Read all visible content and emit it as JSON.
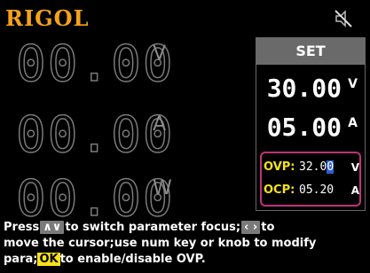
{
  "header": {
    "brand": "RIGOL",
    "mute_icon": "speaker-mute-icon"
  },
  "measurement": {
    "voltage": {
      "value": "00.00",
      "unit": "V"
    },
    "current": {
      "value": "00.00",
      "unit": "A"
    },
    "power": {
      "value": "00.00",
      "unit": "W"
    }
  },
  "set_panel": {
    "title": "SET",
    "voltage": {
      "value": "30.00",
      "unit": "V"
    },
    "current": {
      "value": "05.00",
      "unit": "A"
    },
    "ovp": {
      "label": "OVP:",
      "value_pre": "32.0",
      "value_cursor": "0",
      "unit": "V"
    },
    "ocp": {
      "label": "OCP:",
      "value": "05.20",
      "unit": "A"
    }
  },
  "help": {
    "line1_a": "Press",
    "key_updown": "∧∨",
    "line1_b": "to switch parameter focus;",
    "key_leftright": "‹ ›",
    "line1_c": "to",
    "line2": "move the cursor;use num key or knob to modify",
    "line3_a": "para;",
    "key_ok": "OK",
    "line3_b": "to enable/disable OVP."
  },
  "colors": {
    "brand": "#f4a21a",
    "highlight": "#f6e11a",
    "protection_border": "#c0317a",
    "cursor": "#2f5fd0"
  }
}
